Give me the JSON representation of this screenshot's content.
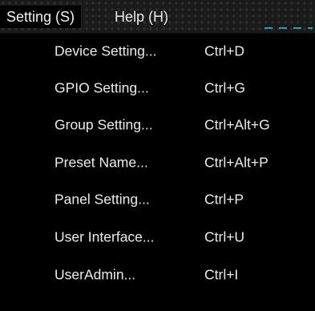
{
  "menubar": {
    "setting_label": "Setting (S)",
    "help_label": "Help (H)"
  },
  "dropdown": {
    "items": [
      {
        "label": "Device Setting...",
        "shortcut": "Ctrl+D"
      },
      {
        "label": "GPIO Setting...",
        "shortcut": "Ctrl+G"
      },
      {
        "label": "Group Setting...",
        "shortcut": "Ctrl+Alt+G"
      },
      {
        "label": "Preset Name...",
        "shortcut": "Ctrl+Alt+P"
      },
      {
        "label": "Panel Setting...",
        "shortcut": "Ctrl+P"
      },
      {
        "label": "User Interface...",
        "shortcut": "Ctrl+U"
      },
      {
        "label": "UserAdmin...",
        "shortcut": "Ctrl+I"
      }
    ]
  },
  "colors": {
    "menu_background": "#000000",
    "menubar_background": "#1a1a1a",
    "text": "#ececec",
    "accent": "#1fb8d8"
  }
}
